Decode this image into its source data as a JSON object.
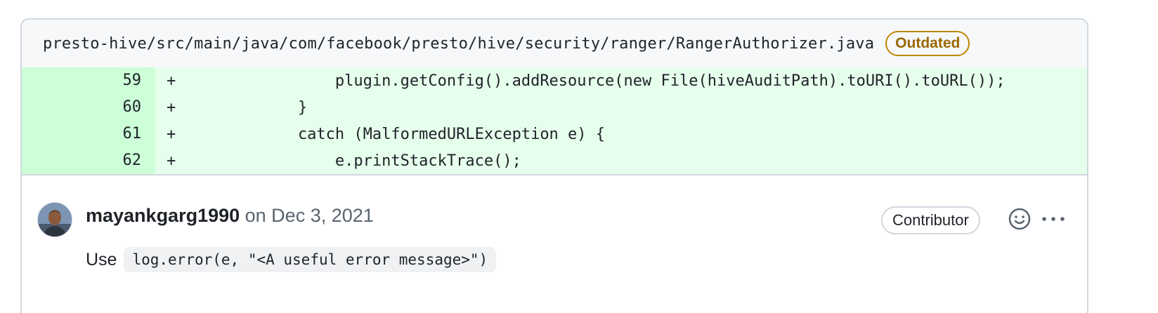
{
  "file": {
    "path": "presto-hive/src/main/java/com/facebook/presto/hive/security/ranger/RangerAuthorizer.java",
    "status_badge": "Outdated"
  },
  "diff": {
    "lines": [
      {
        "num": "59",
        "marker": "+",
        "code": "                plugin.getConfig().addResource(new File(hiveAuditPath).toURI().toURL());"
      },
      {
        "num": "60",
        "marker": "+",
        "code": "            }"
      },
      {
        "num": "61",
        "marker": "+",
        "code": "            catch (MalformedURLException e) {"
      },
      {
        "num": "62",
        "marker": "+",
        "code": "                e.printStackTrace();"
      }
    ]
  },
  "comment": {
    "author": "mayankgarg1990",
    "date_text": " on Dec 3, 2021",
    "role": "Contributor",
    "body_prefix": "Use",
    "body_code": "log.error(e, \"<A useful error message>\")"
  },
  "icons": {
    "avatar": "avatar",
    "reaction": "smiley-icon",
    "more": "kebab-horizontal-icon"
  },
  "colors": {
    "outdated_border": "#bf8700",
    "outdated_text": "#9a6700",
    "added_line_bg": "#e6ffec",
    "added_num_bg": "#ccffd8"
  }
}
